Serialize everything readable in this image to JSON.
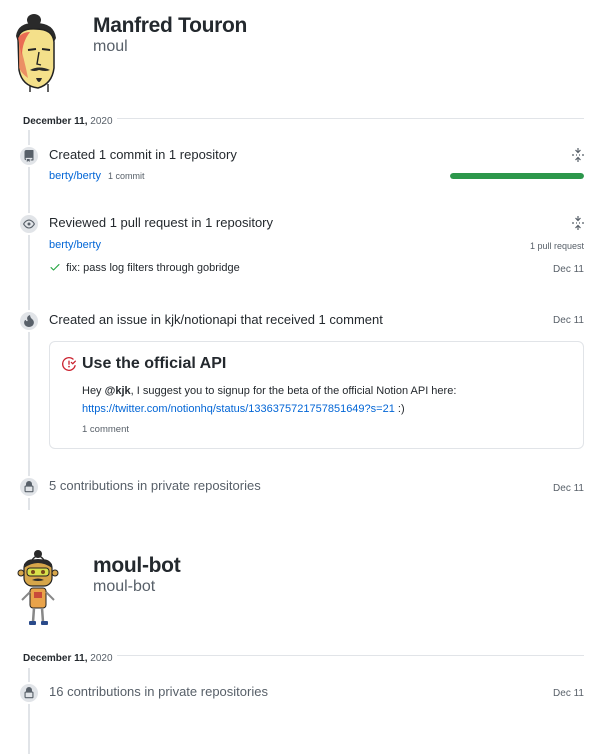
{
  "profiles": [
    {
      "name": "Manfred Touron",
      "login": "moul",
      "date_main": "December 11,",
      "date_year": "2020"
    },
    {
      "name": "moul-bot",
      "login": "moul-bot",
      "date_main": "December 11,",
      "date_year": "2020"
    }
  ],
  "events": {
    "commits": {
      "title": "Created 1 commit in 1 repository",
      "repo": "berty/berty",
      "count_label": "1 commit",
      "progress_fraction": 1.0,
      "progress_color": "#2c974b"
    },
    "review": {
      "title": "Reviewed 1 pull request in 1 repository",
      "repo": "berty/berty",
      "count_label": "1 pull request",
      "pr_title": "fix: pass log filters through gobridge",
      "pr_date": "Dec 11"
    },
    "issue": {
      "title": "Created an issue in kjk/notionapi that received 1 comment",
      "date": "Dec 11",
      "card_title": "Use the official API",
      "body_prefix": "Hey ",
      "mention": "@kjk",
      "body_middle": ", I suggest you to signup for the beta of the official Notion API here:",
      "link": "https://twitter.com/notionhq/status/1336375721757851649?s=21",
      "body_suffix": " :)",
      "comments": "1 comment"
    },
    "private1": {
      "title": "5 contributions in private repositories",
      "date": "Dec 11"
    },
    "private2": {
      "title": "16 contributions in private repositories",
      "date": "Dec 11"
    }
  },
  "icons": {
    "commit": "repo-push-icon",
    "review": "eye-icon",
    "issue": "flame-icon",
    "private": "lock-icon",
    "fold": "fold-icon",
    "issue_state": "issue-closed-icon"
  },
  "colors": {
    "link": "#0366d6",
    "progress": "#2c974b",
    "check": "#28a745",
    "issue_closed": "#cb2431"
  }
}
